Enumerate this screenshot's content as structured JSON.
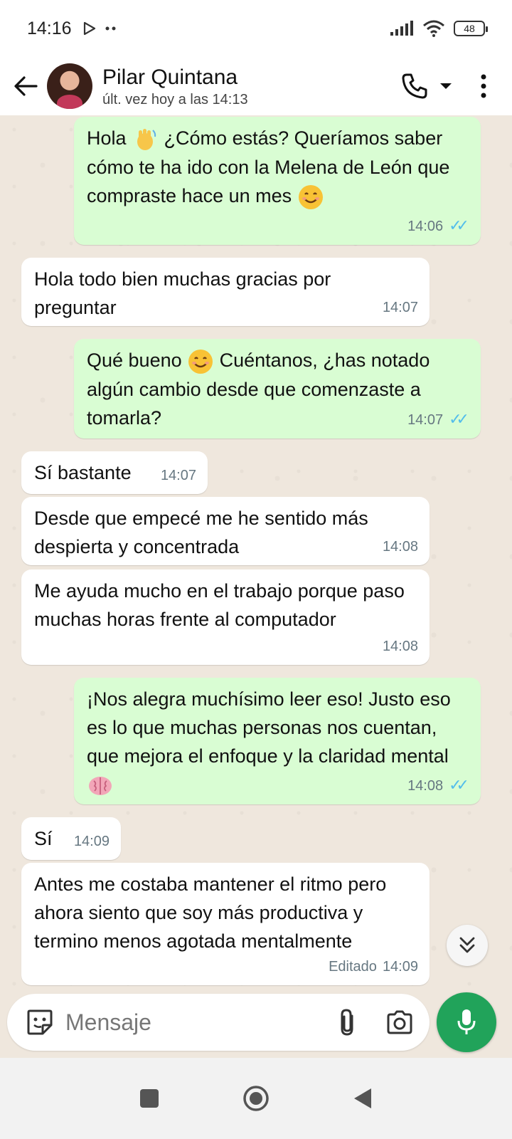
{
  "status_bar": {
    "time": "14:16",
    "battery": "48"
  },
  "header": {
    "contact_name": "Pilar Quintana",
    "last_seen": "últ. vez hoy a las 14:13"
  },
  "messages": [
    {
      "dir": "out",
      "text": "Hola",
      "text2": " ¿Cómo estás? Queríamos saber cómo te ha ido con la Melena de León que compraste hace un mes ",
      "time": "14:06",
      "emoji1": "waving-hand-emoji",
      "emoji2": "smiling-face-emoji"
    },
    {
      "dir": "in",
      "text": "Hola todo bien muchas gracias por preguntar",
      "time": "14:07"
    },
    {
      "dir": "out",
      "text": "Qué bueno ",
      "text2": " Cuéntanos, ¿has notado algún cambio desde que comenzaste a tomarla?",
      "time": "14:07",
      "emoji1": "smiling-face-emoji"
    },
    {
      "dir": "in",
      "text": "Sí bastante",
      "time": "14:07"
    },
    {
      "dir": "in",
      "text": "Desde que empecé me he sentido más despierta y concentrada",
      "time": "14:08"
    },
    {
      "dir": "in",
      "text": "Me ayuda mucho en el trabajo porque paso muchas horas frente al computador",
      "time": "14:08"
    },
    {
      "dir": "out",
      "text": "¡Nos alegra muchísimo leer eso! Justo eso es lo que muchas personas nos cuentan, que mejora el enfoque y la claridad mental ",
      "time": "14:08",
      "emoji1": "brain-emoji"
    },
    {
      "dir": "in",
      "text": "Sí",
      "time": "14:09"
    },
    {
      "dir": "in",
      "text": "Antes me costaba mantener el ritmo pero ahora siento que soy más productiva y termino menos agotada mentalmente",
      "time": "14:09",
      "edited": "Editado"
    }
  ],
  "composer": {
    "placeholder": "Mensaje"
  },
  "colors": {
    "outgoing": "#d9fdd3",
    "incoming": "#ffffff",
    "accent": "#21a35a",
    "read_ticks": "#53bdeb"
  },
  "icons": [
    "back-arrow-icon",
    "phone-icon",
    "dropdown-icon",
    "more-icon",
    "chevron-double-down-icon",
    "sticker-icon",
    "paperclip-icon",
    "camera-icon",
    "mic-icon",
    "nav-square-icon",
    "nav-home-icon",
    "nav-back-icon"
  ]
}
